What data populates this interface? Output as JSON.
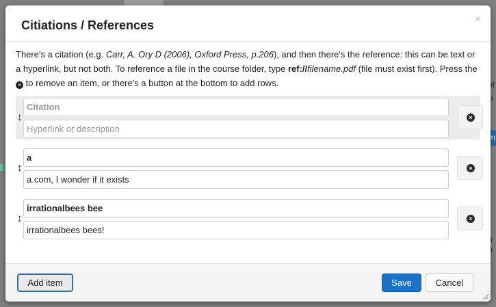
{
  "dialog": {
    "title": "Citiations / References",
    "close_glyph": "×"
  },
  "intro": {
    "t1": "There's a citation (e.g. ",
    "example_citation": "Carr, A. Ory D (2006), Oxford Press, p.206",
    "t2": "), and then there's the reference: this can be text or a hyperlink, but not both. To reference a file in the course folder, type ",
    "ref_prefix": "ref://",
    "ref_file": "filename.pdf",
    "t3": " (file must exist first). Press the ",
    "t4": " to remove an item, or there's a button at the bottom to add rows."
  },
  "rows": [
    {
      "citation_value": "",
      "citation_placeholder": "Citation",
      "link_value": "",
      "link_placeholder": "Hyperlink or description"
    },
    {
      "citation_value": "a",
      "citation_placeholder": "Citation",
      "link_value": "a.com, I wonder if it exists",
      "link_placeholder": "Hyperlink or description"
    },
    {
      "citation_value": "irrationalbees bee",
      "citation_placeholder": "Citation",
      "link_value": "irrationalbees bees!",
      "link_placeholder": "Hyperlink or description"
    }
  ],
  "footer": {
    "add_label": "Add item",
    "save_label": "Save",
    "cancel_label": "Cancel"
  },
  "icons": {
    "drag": "move-vertical-icon",
    "remove": "remove-circle-icon",
    "close": "close-icon"
  },
  "colors": {
    "primary": "#1a73c9",
    "focus_border": "#2f6fb0"
  }
}
